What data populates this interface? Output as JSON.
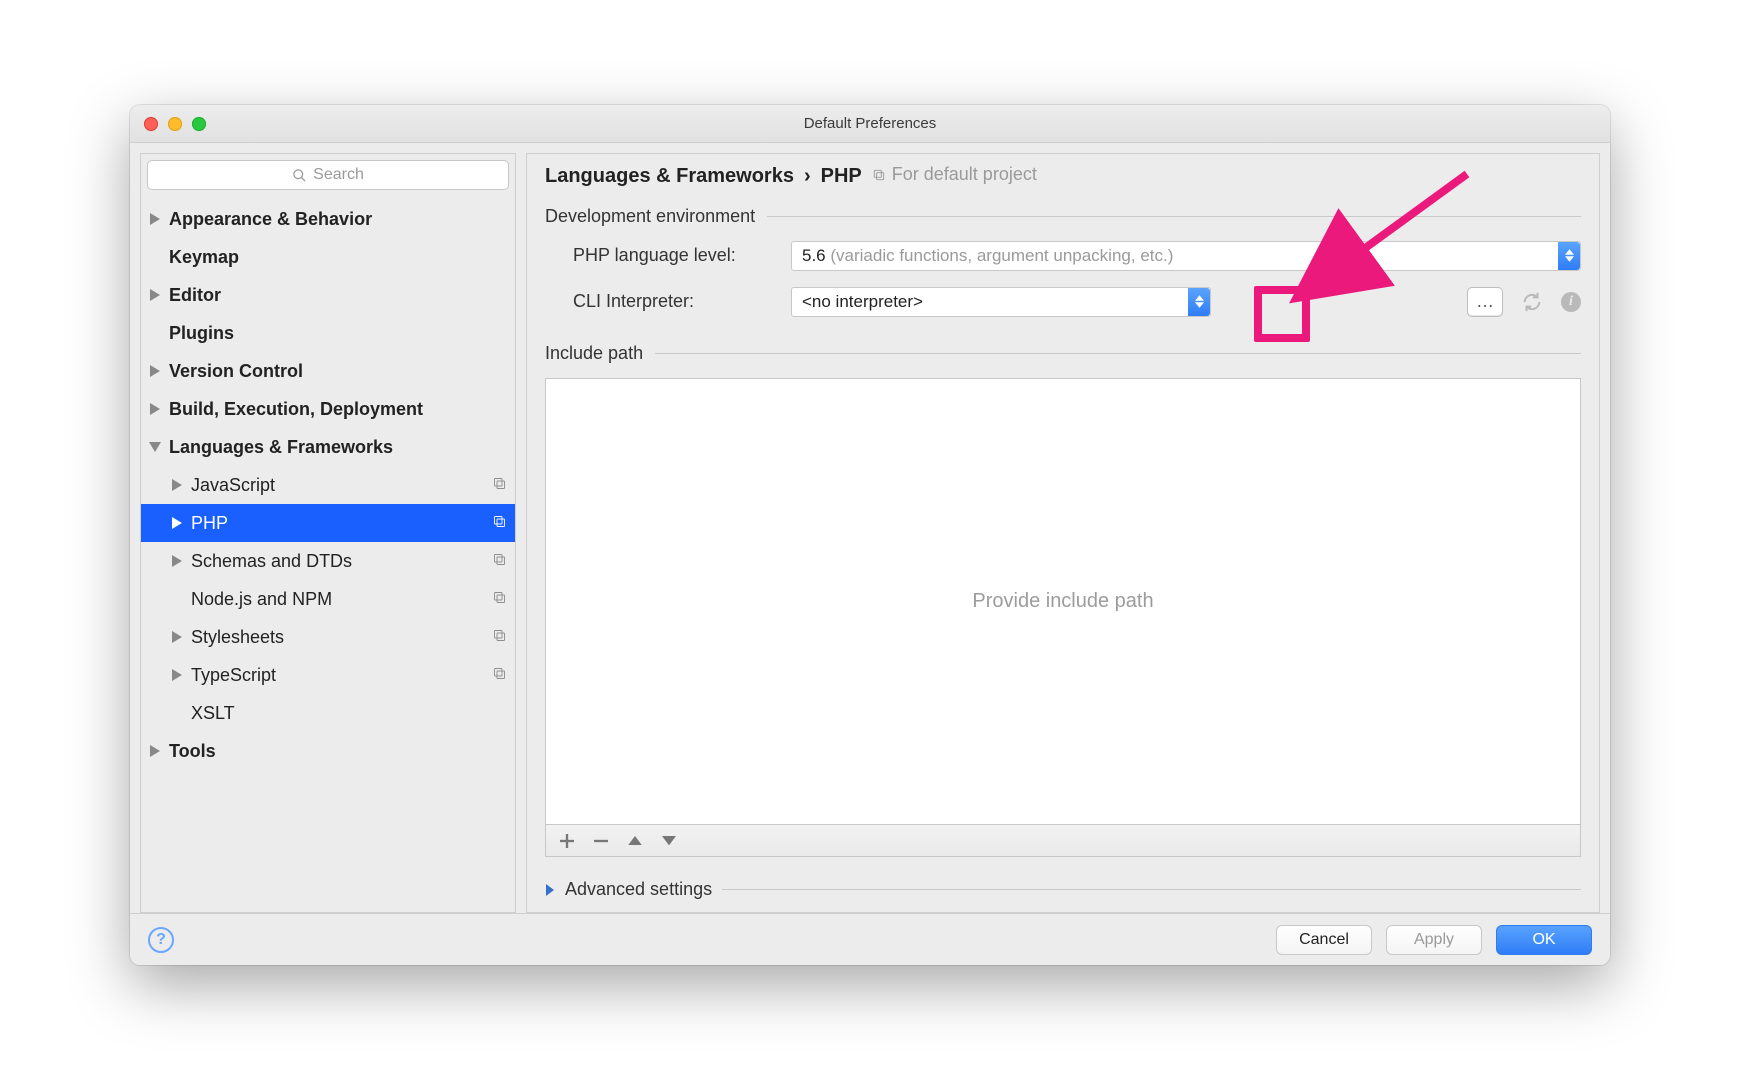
{
  "window": {
    "title": "Default Preferences"
  },
  "search": {
    "placeholder": "Search"
  },
  "sidebar": {
    "items": [
      {
        "label": "Appearance & Behavior",
        "bold": true,
        "expandable": true,
        "indent": 0,
        "mark": false
      },
      {
        "label": "Keymap",
        "bold": true,
        "expandable": false,
        "indent": 0,
        "mark": false
      },
      {
        "label": "Editor",
        "bold": true,
        "expandable": true,
        "indent": 0,
        "mark": false
      },
      {
        "label": "Plugins",
        "bold": true,
        "expandable": false,
        "indent": 0,
        "mark": false
      },
      {
        "label": "Version Control",
        "bold": true,
        "expandable": true,
        "indent": 0,
        "mark": false
      },
      {
        "label": "Build, Execution, Deployment",
        "bold": true,
        "expandable": true,
        "indent": 0,
        "mark": false
      },
      {
        "label": "Languages & Frameworks",
        "bold": true,
        "expandable": true,
        "indent": 0,
        "mark": false,
        "expanded": true
      },
      {
        "label": "JavaScript",
        "bold": false,
        "expandable": true,
        "indent": 1,
        "mark": true
      },
      {
        "label": "PHP",
        "bold": false,
        "expandable": true,
        "indent": 1,
        "mark": true,
        "selected": true
      },
      {
        "label": "Schemas and DTDs",
        "bold": false,
        "expandable": true,
        "indent": 1,
        "mark": true
      },
      {
        "label": "Node.js and NPM",
        "bold": false,
        "expandable": false,
        "indent": 1,
        "mark": true
      },
      {
        "label": "Stylesheets",
        "bold": false,
        "expandable": true,
        "indent": 1,
        "mark": true
      },
      {
        "label": "TypeScript",
        "bold": false,
        "expandable": true,
        "indent": 1,
        "mark": true
      },
      {
        "label": "XSLT",
        "bold": false,
        "expandable": false,
        "indent": 1,
        "mark": false
      },
      {
        "label": "Tools",
        "bold": true,
        "expandable": true,
        "indent": 0,
        "mark": false
      }
    ]
  },
  "breadcrumb": {
    "parent": "Languages & Frameworks",
    "current": "PHP",
    "scope": "For default project"
  },
  "development_environment": {
    "section_title": "Development environment",
    "lang_level_label": "PHP language level:",
    "lang_level_value": "5.6",
    "lang_level_hint": "(variadic functions, argument unpacking, etc.)",
    "cli_label": "CLI Interpreter:",
    "cli_value": "<no interpreter>",
    "more_button": "…"
  },
  "include_path": {
    "section_title": "Include path",
    "placeholder": "Provide include path"
  },
  "advanced": {
    "label": "Advanced settings"
  },
  "footer": {
    "cancel": "Cancel",
    "apply": "Apply",
    "ok": "OK"
  },
  "annotation": {
    "highlight_color": "#ec197d"
  }
}
